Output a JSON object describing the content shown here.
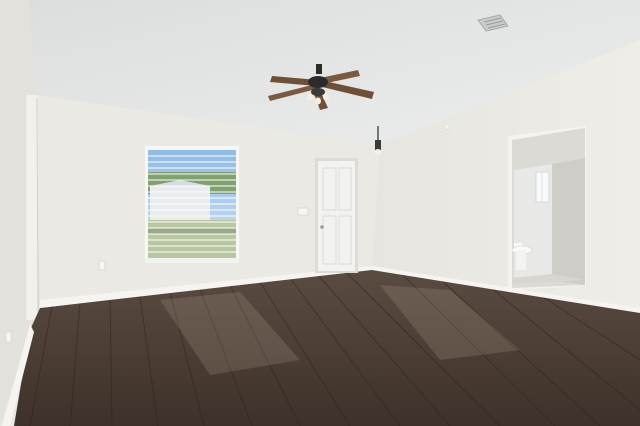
{
  "scene": {
    "subject": "empty-room-interior",
    "colors": {
      "ceiling": "#e4e5e4",
      "wall_back": "#ebe9e4",
      "wall_left": "#e6e4df",
      "wall_right": "#e9e7e2",
      "floor_base": "#4a3c33",
      "floor_highlight": "#6a5a4e",
      "baseboard": "#f4f3f0",
      "door": "#f1f1ef",
      "fan_blade": "#7a5a40",
      "fan_body": "#2b2b2b",
      "window_sky": "#9fc4e6",
      "window_frame": "#f6f6f4"
    },
    "icons": [
      "ceiling-fan-icon",
      "pendant-light-icon",
      "air-vent-icon",
      "window-icon",
      "door-icon",
      "toilet-icon"
    ]
  }
}
